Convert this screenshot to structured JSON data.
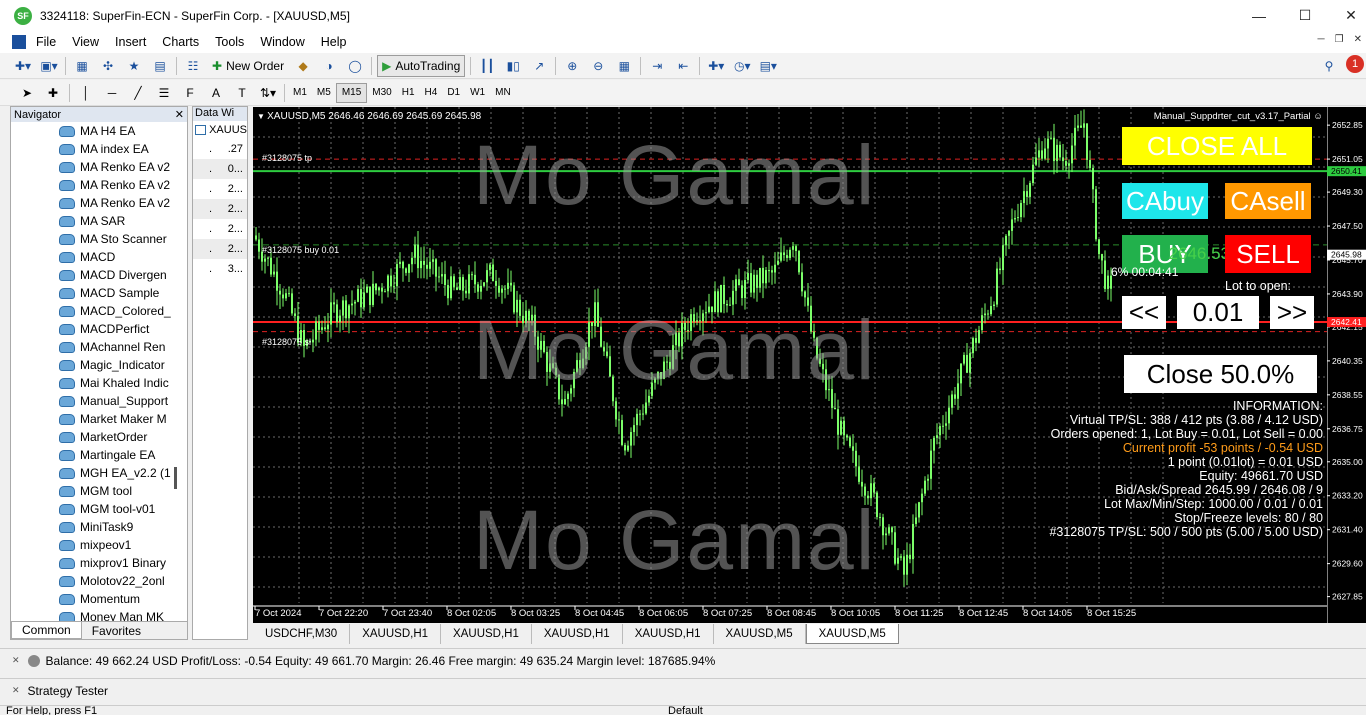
{
  "window": {
    "title": "3324118: SuperFin-ECN - SuperFin Corp. - [XAUUSD,M5]",
    "logo_text": "SF"
  },
  "menu": [
    "File",
    "View",
    "Insert",
    "Charts",
    "Tools",
    "Window",
    "Help"
  ],
  "toolbar": {
    "new_order": "New Order",
    "autotrading": "AutoTrading"
  },
  "timeframes": [
    "M1",
    "M5",
    "M15",
    "M30",
    "H1",
    "H4",
    "D1",
    "W1",
    "MN"
  ],
  "active_timeframe": "M15",
  "notification_count": "1",
  "navigator": {
    "title": "Navigator",
    "items": [
      "MA H4 EA",
      "MA index EA",
      "MA Renko EA v2",
      "MA Renko EA v2",
      "MA Renko EA v2",
      "MA SAR",
      "MA Sto Scanner",
      "MACD",
      "MACD Divergen",
      "MACD Sample",
      "MACD_Colored_",
      "MACDPerfict",
      "MAchannel Ren",
      "Magic_Indicator",
      "Mai Khaled Indic",
      "Manual_Support",
      "Market Maker M",
      "MarketOrder",
      "Martingale EA",
      "MGH EA_v2.2 (1",
      "MGM tool",
      "MGM tool-v01",
      "MiniTask9",
      "mixpeov1",
      "mixprov1 Binary",
      "Molotov22_2onl",
      "Momentum",
      "Money Man MK"
    ],
    "tabs": [
      "Common",
      "Favorites"
    ]
  },
  "data_window": {
    "title": "Data Wi",
    "symbol": "XAUUS",
    "rows": [
      ".27",
      "0...",
      "2...",
      "2...",
      "2...",
      "2...",
      "3..."
    ]
  },
  "chart": {
    "symbol_header": "XAUUSD,M5  2646.46 2646.69 2645.69 2645.98",
    "ea_name": "Manual_Suppdrter_cut_v3.17_Partial",
    "watermark": "Mo Gamal",
    "labels": {
      "tp": "#3128075 tp",
      "buy": "#3128075 buy 0.01",
      "sl": "#3128075 sl"
    },
    "price_ticks": [
      "2652.85",
      "2651.05",
      "2649.30",
      "2647.50",
      "2645.70",
      "2643.90",
      "2642.15",
      "2640.35",
      "2638.55",
      "2636.75",
      "2635.00",
      "2633.20",
      "2631.40",
      "2629.60",
      "2627.85"
    ],
    "price_tags": {
      "tp": "2650.41",
      "current": "2645.98",
      "sl": "2642.41"
    },
    "time_ticks": [
      "7 Oct 2024",
      "7 Oct 22:20",
      "7 Oct 23:40",
      "8 Oct 02:05",
      "8 Oct 03:25",
      "8 Oct 04:45",
      "8 Oct 06:05",
      "8 Oct 07:25",
      "8 Oct 08:45",
      "8 Oct 10:05",
      "8 Oct 11:25",
      "8 Oct 12:45",
      "8 Oct 14:05",
      "8 Oct 15:25"
    ],
    "colors": {
      "candle": "#7cff6a",
      "tp_line": "#2ecc40",
      "sl_line": "#ff2020"
    }
  },
  "panel": {
    "close_all": "CLOSE ALL",
    "ca_buy": "CAbuy",
    "ca_sell": "CAsell",
    "buy": "BUY",
    "sell": "SELL",
    "buy_overlay": "2646.53",
    "timer": "6%   00:04:41",
    "lot_label": "Lot to open:",
    "lot_dec": "<<",
    "lot_value": "0.01",
    "lot_inc": ">>",
    "close_partial": "Close 50.0%",
    "info": [
      "INFORMATION:",
      "Virtual TP/SL: 388 / 412 pts (3.88 / 4.12 USD)",
      "Orders opened: 1, Lot Buy = 0.01, Lot Sell = 0.00",
      "Current profit -53 points / -0.54 USD",
      "1 point (0.01lot) = 0.01 USD",
      "Equity: 49661.70 USD",
      "Bid/Ask/Spread 2645.99 / 2646.08 / 9",
      "Lot Max/Min/Step: 1000.00 / 0.01 / 0.01",
      "Stop/Freeze levels: 80 / 80",
      "#3128075 TP/SL: 500 / 500 pts (5.00 / 5.00 USD)"
    ]
  },
  "chart_tabs": [
    "USDCHF,M30",
    "XAUUSD,H1",
    "XAUUSD,H1",
    "XAUUSD,H1",
    "XAUUSD,H1",
    "XAUUSD,M5",
    "XAUUSD,M5"
  ],
  "account_line": "Balance: 49 662.24 USD  Profit/Loss: -0.54  Equity: 49 661.70  Margin: 26.46  Free margin: 49 635.24  Margin level: 187685.94%",
  "tester_label": "Strategy Tester",
  "status": {
    "left": "For Help, press F1",
    "mid": "Default"
  }
}
